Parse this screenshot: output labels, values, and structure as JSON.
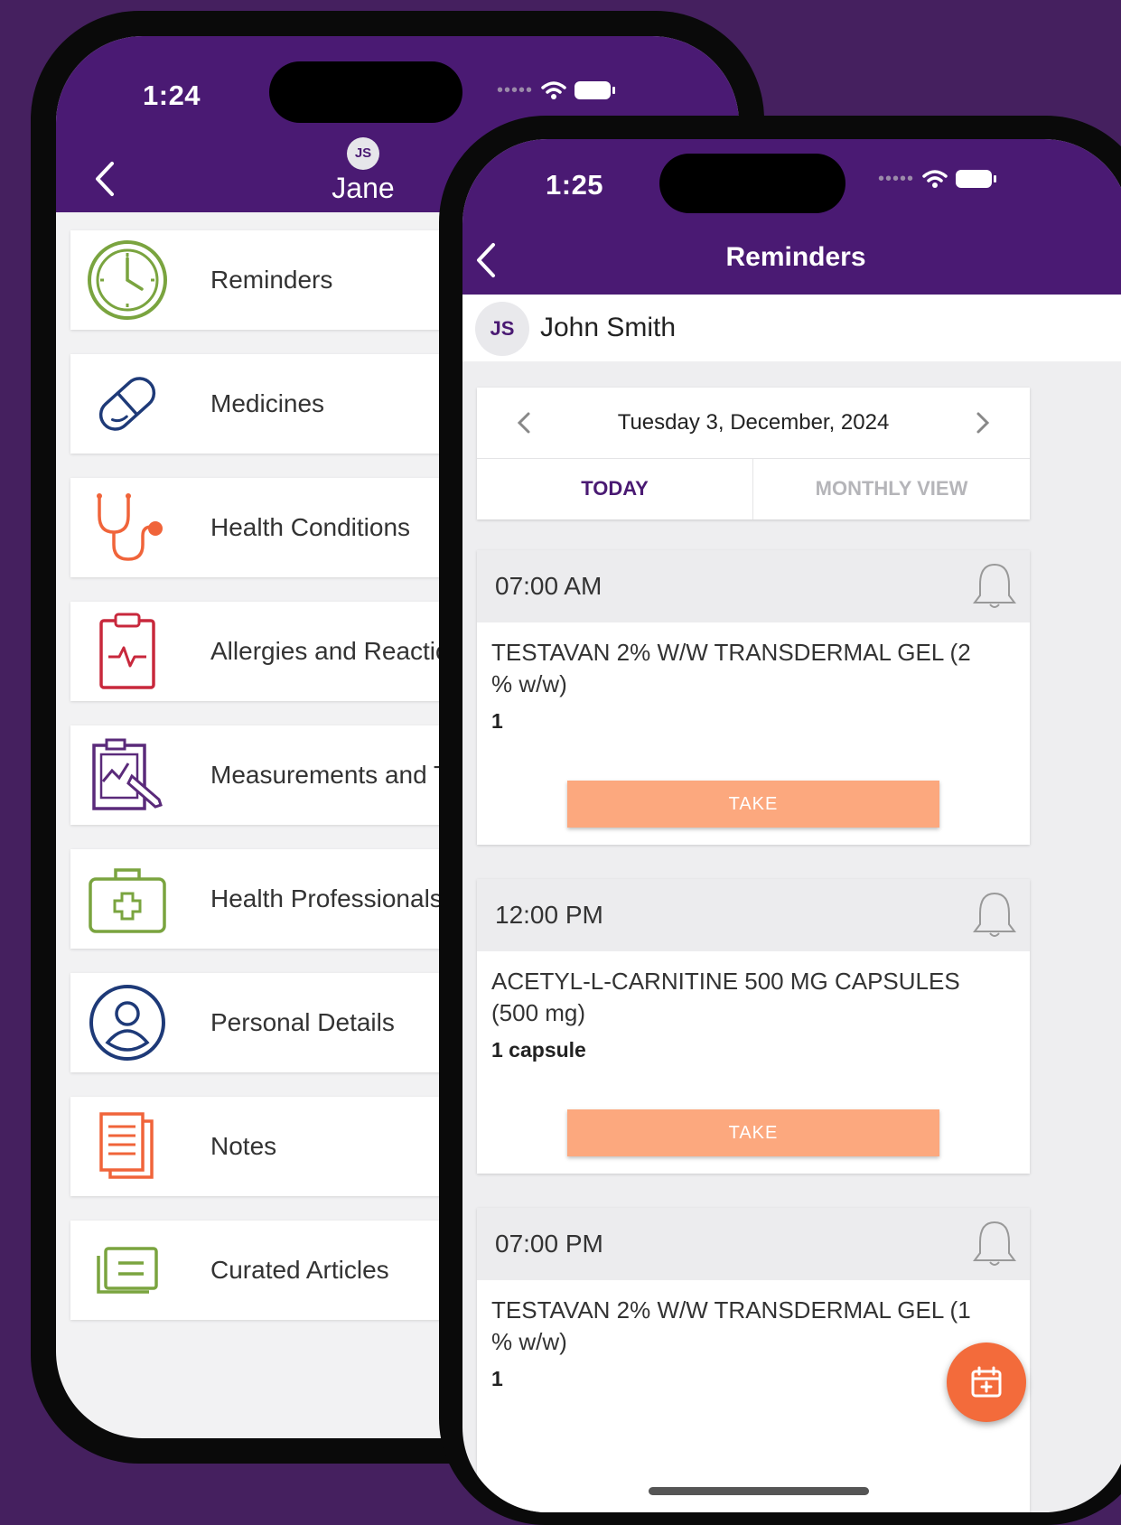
{
  "back_phone": {
    "status_time": "1:24",
    "avatar_initials": "JS",
    "header_name": "Jane",
    "menu": [
      {
        "label": "Reminders",
        "icon": "clock-icon",
        "color": "#7aa43f"
      },
      {
        "label": "Medicines",
        "icon": "pill-icon",
        "color": "#1e3a78"
      },
      {
        "label": "Health Conditions",
        "icon": "stethoscope-icon",
        "color": "#f0643a"
      },
      {
        "label": "Allergies and Reactions",
        "icon": "clipboard-pulse-icon",
        "color": "#c8283c"
      },
      {
        "label": "Measurements and Tests",
        "icon": "measurement-chart-icon",
        "color": "#5a2a7a"
      },
      {
        "label": "Health Professionals",
        "icon": "medical-kit-icon",
        "color": "#7aa43f"
      },
      {
        "label": "Personal Details",
        "icon": "user-circle-icon",
        "color": "#1e3a78"
      },
      {
        "label": "Notes",
        "icon": "notes-icon",
        "color": "#f0643a"
      },
      {
        "label": "Curated Articles",
        "icon": "articles-icon",
        "color": "#7aa43f"
      }
    ]
  },
  "front_phone": {
    "status_time": "1:25",
    "header_title": "Reminders",
    "user_initials": "JS",
    "user_name": "John Smith",
    "date_label": "Tuesday 3, December, 2024",
    "tabs": {
      "today": "TODAY",
      "monthly": "MONTHLY VIEW"
    },
    "doses": [
      {
        "time": "07:00 AM",
        "name": "TESTAVAN 2% W/W TRANSDERMAL GEL (2 % w/w)",
        "qty": "1",
        "action": "TAKE"
      },
      {
        "time": "12:00 PM",
        "name": "ACETYL-L-CARNITINE 500 MG CAPSULES (500 mg)",
        "qty": "1 capsule",
        "action": "TAKE"
      },
      {
        "time": "07:00 PM",
        "name": "TESTAVAN 2% W/W TRANSDERMAL GEL (1 % w/w)",
        "qty": "1"
      }
    ]
  },
  "colors": {
    "background": "#45205f",
    "header": "#4a1a73",
    "accent_orange": "#f36b3b",
    "take_button": "#fca87e",
    "today_tab": "#4a1a73"
  }
}
